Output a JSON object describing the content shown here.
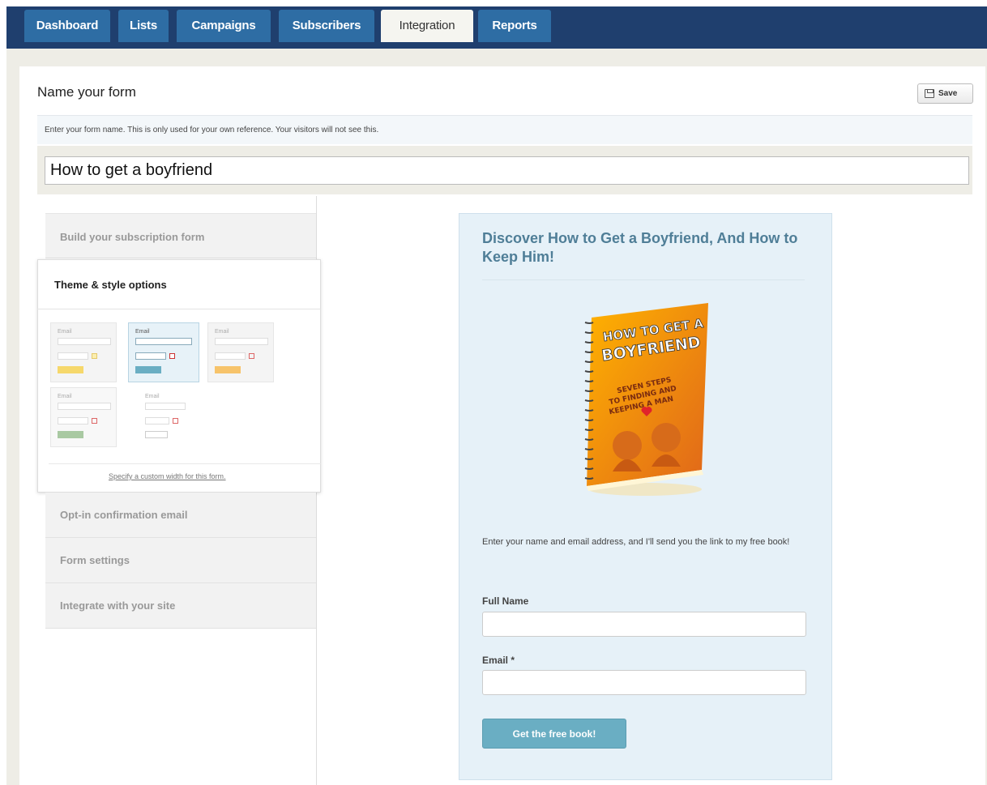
{
  "nav": {
    "tabs": [
      {
        "label": "Dashboard",
        "active": false
      },
      {
        "label": "Lists",
        "active": false
      },
      {
        "label": "Campaigns",
        "active": false
      },
      {
        "label": "Subscribers",
        "active": false
      },
      {
        "label": "Integration",
        "active": true
      },
      {
        "label": "Reports",
        "active": false
      }
    ]
  },
  "form_name": {
    "title": "Name your form",
    "save_label": "Save",
    "hint": "Enter your form name. This is only used for your own reference. Your visitors will not see this.",
    "value": "How to get a boyfriend"
  },
  "sidebar": {
    "build_label": "Build your subscription form",
    "theme_title": "Theme & style options",
    "custom_width_link": "Specify a custom width for this form.",
    "theme_field_label": "Email",
    "optin_label": "Opt-in confirmation email",
    "settings_label": "Form settings",
    "integrate_label": "Integrate with your site"
  },
  "preview": {
    "headline": "Discover How to Get a Boyfriend, And How to Keep Him!",
    "book": {
      "title_line1": "HOW TO GET A",
      "title_line2": "BOYFRIEND",
      "subtitle_line1": "SEVEN STEPS",
      "subtitle_line2": "TO FINDING AND",
      "subtitle_line3": "KEEPING A MAN"
    },
    "description": "Enter your name and email address, and I'll send you the link to my free book!",
    "full_name_label": "Full Name",
    "email_label": "Email *",
    "submit_label": "Get the free book!"
  },
  "colors": {
    "nav_bg": "#1f3f6e",
    "tab_bg": "#2e6da4",
    "card_bg": "#e6f1f8",
    "headline": "#4f7e97",
    "button": "#6aaec3"
  }
}
